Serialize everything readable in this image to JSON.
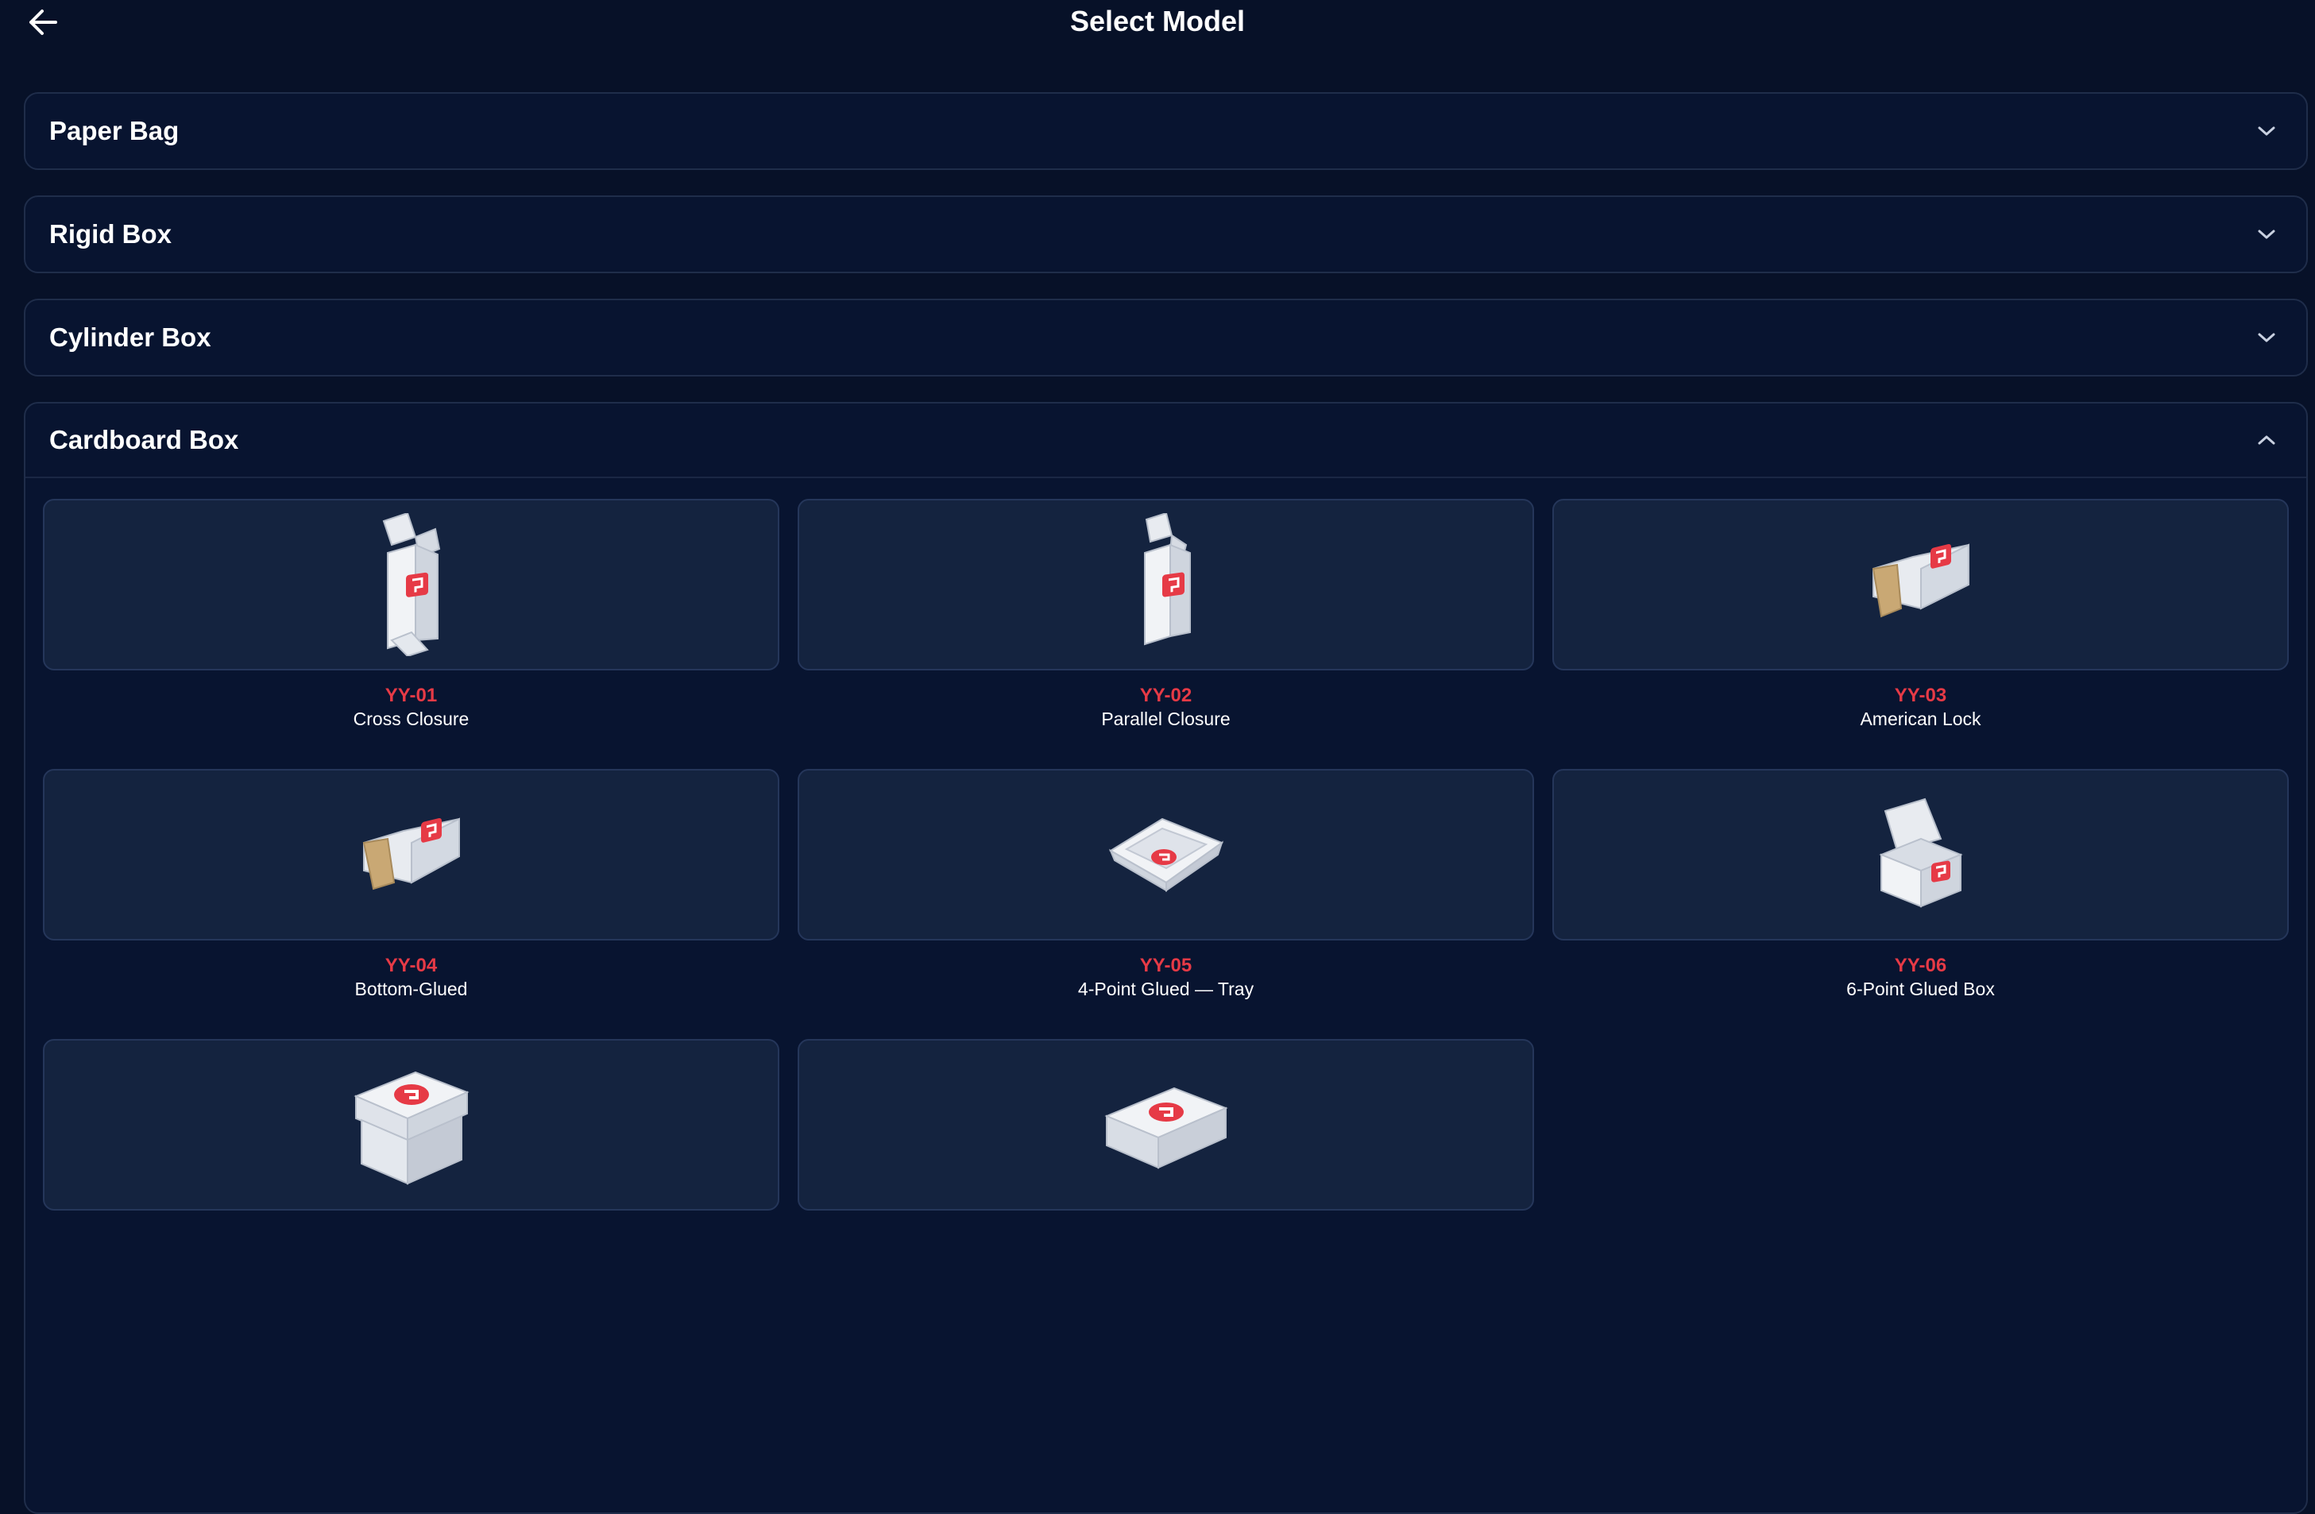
{
  "header": {
    "title": "Select Model",
    "back_icon": "arrow-left-icon"
  },
  "categories": [
    {
      "label": "Paper Bag",
      "expanded": false,
      "icon": "chevron-down-icon"
    },
    {
      "label": "Rigid Box",
      "expanded": false,
      "icon": "chevron-down-icon"
    },
    {
      "label": "Cylinder Box",
      "expanded": false,
      "icon": "chevron-down-icon"
    },
    {
      "label": "Cardboard Box",
      "expanded": true,
      "icon": "chevron-up-icon"
    }
  ],
  "models": [
    {
      "code": "YY-01",
      "name": "Cross Closure",
      "image": "tall-carton-open-icon"
    },
    {
      "code": "YY-02",
      "name": "Parallel Closure",
      "image": "tall-carton-open-icon"
    },
    {
      "code": "YY-03",
      "name": "American Lock",
      "image": "tuck-box-side-icon"
    },
    {
      "code": "YY-04",
      "name": "Bottom-Glued",
      "image": "tuck-box-side-icon"
    },
    {
      "code": "YY-05",
      "name": "4-Point Glued — Tray",
      "image": "tray-icon"
    },
    {
      "code": "YY-06",
      "name": "6-Point Glued Box",
      "image": "lid-box-open-icon"
    },
    {
      "code": "",
      "name": "",
      "image": "lid-box-closed-icon"
    },
    {
      "code": "",
      "name": "",
      "image": "sleeve-box-icon"
    }
  ],
  "colors": {
    "background": "#071128",
    "card": "#14233f",
    "accent_red": "#e63a46",
    "border": "#1f2d4a"
  }
}
